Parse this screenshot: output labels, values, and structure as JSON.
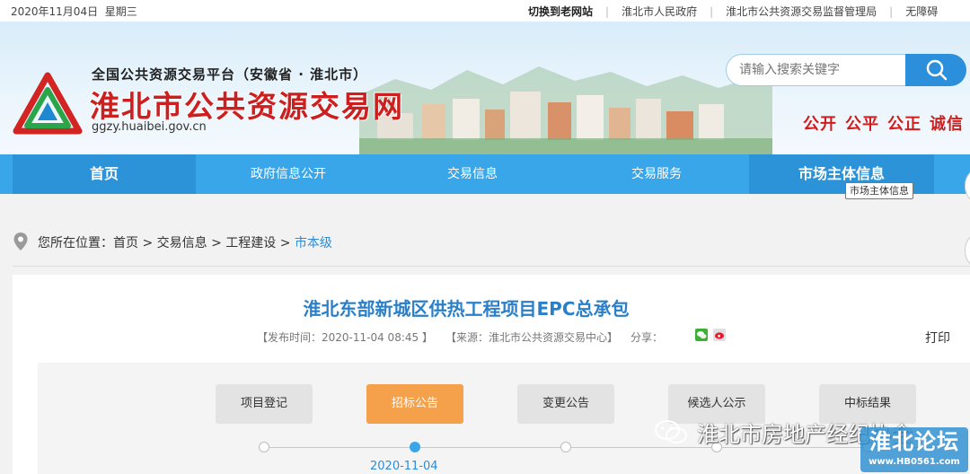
{
  "topbar": {
    "date": "2020年11月04日",
    "weekday": "星期三",
    "links": [
      "切换到老网站",
      "淮北市人民政府",
      "淮北市公共资源交易监督管理局",
      "无障碍"
    ]
  },
  "header": {
    "platform": "全国公共资源交易平台（安徽省 · 淮北市）",
    "site_name": "淮北市公共资源交易网",
    "domain": "ggzy.huaibei.gov.cn",
    "search_placeholder": "请输入搜索关键字",
    "slogan": [
      "公开",
      "公平",
      "公正",
      "诚信"
    ]
  },
  "nav": {
    "items": [
      "首页",
      "政府信息公开",
      "交易信息",
      "交易服务",
      "市场主体信息"
    ],
    "tooltip": "市场主体信息"
  },
  "breadcrumb": {
    "prefix": "您所在位置：",
    "items": [
      "首页",
      "交易信息",
      "工程建设",
      "市本级"
    ],
    "separator": " > "
  },
  "article": {
    "title": "淮北东部新城区供热工程项目EPC总承包",
    "publish_label": "【发布时间：2020-11-04 08:45 】",
    "source_label": "【来源：淮北市公共资源交易中心】",
    "share_label": "分享：",
    "print_label": "打印"
  },
  "steps": {
    "items": [
      "项目登记",
      "招标公告",
      "变更公告",
      "候选人公示",
      "中标结果"
    ],
    "active_index": 1,
    "active_date": "2020-11-04"
  },
  "watermark": {
    "text": "淮北市房地产经纪协会",
    "forum_title": "淮北论坛",
    "forum_url": "www.HB0561.com"
  },
  "colors": {
    "nav_bg": "#3aa6ea",
    "nav_active": "#2c93d9",
    "brand_red": "#cc1f1f",
    "title_blue": "#2a7fc8",
    "step_active": "#f5a04b"
  }
}
